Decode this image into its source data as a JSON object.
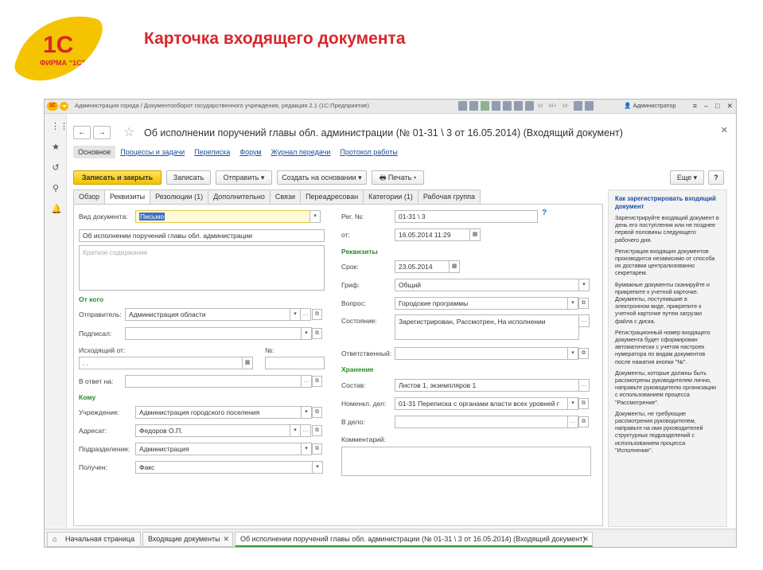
{
  "slide": {
    "title": "Карточка входящего документа",
    "logo_text": "ФИРМА “1С”",
    "logo_mark": "1С"
  },
  "window": {
    "title": "Администрация города / Документооборот государственного учреждения, редакция 2.1 (1С:Предприятие)",
    "user": "Администратор",
    "m_labels": [
      "M",
      "M+",
      "M-"
    ]
  },
  "document": {
    "title": "Об исполнении поручений главы обл. администрации (№ 01-31 \\ 3 от 16.05.2014) (Входящий документ)",
    "nav_links": [
      {
        "label": "Основное",
        "active": true
      },
      {
        "label": "Процессы и задачи"
      },
      {
        "label": "Переписка"
      },
      {
        "label": "Форум"
      },
      {
        "label": "Журнал передачи"
      },
      {
        "label": "Протокол работы"
      }
    ],
    "toolbar": {
      "save_close": "Записать и закрыть",
      "save": "Записать",
      "send": "Отправить",
      "create_based": "Создать на основании",
      "print": "Печать",
      "more": "Еще",
      "help": "?"
    },
    "tabs": [
      "Обзор",
      "Реквизиты",
      "Резолюции (1)",
      "Дополнительно",
      "Связи",
      "Переадресован",
      "Категории (1)",
      "Рабочая группа"
    ],
    "active_tab": "Реквизиты"
  },
  "form": {
    "doc_type_label": "Вид документа:",
    "doc_type_value": "Письмо",
    "subject_value": "Об исполнении поручений главы обл. администрации",
    "summary_placeholder": "Краткое содержание",
    "from_section": "От кого",
    "sender_label": "Отправитель:",
    "sender_value": "Администрация области",
    "signed_label": "Подписал:",
    "signed_value": "",
    "outgoing_label": "Исходящий от:",
    "outgoing_date_value": " .  .",
    "number_label": "№:",
    "reply_label": "В ответ на:",
    "to_section": "Кому",
    "org_label": "Учреждение:",
    "org_value": "Администрация городского поселения",
    "addressee_label": "Адресат:",
    "addressee_value": "Федоров О.П.",
    "dept_label": "Подразделение:",
    "dept_value": "Администрация",
    "received_label": "Получен:",
    "received_value": "Факс",
    "reg_no_label": "Рег. №:",
    "reg_no_value": "01-31 \\ 3",
    "from_date_label": "от:",
    "from_date_value": "16.05.2014 11:29",
    "requisites_section": "Реквизиты",
    "due_label": "Срок:",
    "due_value": "23.05.2014",
    "grif_label": "Гриф:",
    "grif_value": "Общий",
    "question_label": "Вопрос:",
    "question_value": "Городские программы",
    "state_label": "Состояние:",
    "state_value": "Зарегистрирован, Рассмотрен, На исполнении",
    "responsible_label": "Ответственный:",
    "storage_section": "Хранение",
    "composition_label": "Состав:",
    "composition_value": "Листов 1, экземпляров 1",
    "nomenclature_label": "Номенкл. дел:",
    "nomenclature_value": "01-31 Переписка с органами власти всех уровней г",
    "case_label": "В дело:",
    "comment_label": "Комментарий:",
    "help_mark": "?"
  },
  "help": {
    "title": "Как зарегистрировать входящий документ",
    "paragraphs": [
      "Зарегистрируйте входящий документ в день его поступления или не позднее первой половины следующего рабочего дня.",
      "Регистрация входящих документов производится независимо от способа их доставки централизованно секретарем.",
      "Бумажные документы сканируйте и прикрепите к учетной карточке. Документы, поступившие в электронном виде, прикрепите к учетной карточке путем загрузки файла с диска.",
      "Регистрационный номер входящего документа будет сформирован автоматически с учетом настроек нумератора по видам документов после нажатия кнопки \"№\".",
      "Документы, которые должны быть рассмотрены руководителем лично, направьте руководителю организации с использованием процесса \"Рассмотрение\".",
      "Документы, не требующие рассмотрения руководителем, направьте на имя руководителей структурных подразделений с использованием процесса \"Исполнение\"."
    ]
  },
  "bottom_tabs": {
    "home": "Начальная страница",
    "incoming": "Входящие документы",
    "current": "Об исполнении поручений главы обл. администрации (№ 01-31 \\ 3 от 16.05.2014) (Входящий документ)"
  },
  "colors": {
    "title_red": "#d8262b",
    "logo_yellow": "#f5c400",
    "section_green": "#2a8a2a",
    "link_blue": "#1a4fa3",
    "primary_button": "#f2c200"
  }
}
